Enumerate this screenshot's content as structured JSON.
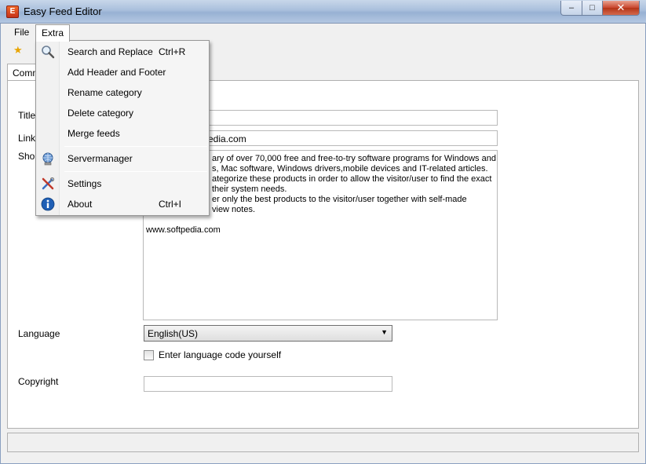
{
  "window": {
    "title": "Easy Feed Editor",
    "app_icon_letter": "E",
    "controls": {
      "minimize": "–",
      "maximize": "□",
      "close": "✕"
    }
  },
  "menubar": {
    "file": "File",
    "extra": "Extra"
  },
  "toolbar": {
    "new_icon": "star-icon"
  },
  "tab": {
    "label": "Comm"
  },
  "form": {
    "title_label": "Title",
    "title_value": "",
    "link_label": "Link",
    "link_value": "edia.com",
    "short_label": "Shor",
    "description_lines": [
      "ary of over 70,000 free and free-to-try software programs for Windows and",
      "s, Mac software, Windows drivers,mobile devices and IT-related articles.",
      "ategorize these products in order to allow the visitor/user to find the exact",
      "their system needs.",
      "er only the best products to the visitor/user together with self-made",
      "view notes.",
      "",
      "www.softpedia.com"
    ],
    "language_label": "Language",
    "language_value": "English(US)",
    "checkbox_label": "Enter language code yourself",
    "copyright_label": "Copyright",
    "copyright_value": ""
  },
  "extra_menu": {
    "items": [
      {
        "label": "Search and Replace",
        "shortcut": "Ctrl+R",
        "icon": "magnifier-icon"
      },
      {
        "label": "Add Header and Footer",
        "shortcut": "",
        "icon": ""
      },
      {
        "label": "Rename category",
        "shortcut": "",
        "icon": ""
      },
      {
        "label": "Delete category",
        "shortcut": "",
        "icon": ""
      },
      {
        "label": "Merge feeds",
        "shortcut": "",
        "icon": ""
      },
      {
        "label": "Servermanager",
        "shortcut": "",
        "icon": "server-globe-icon"
      },
      {
        "label": "Settings",
        "shortcut": "",
        "icon": "settings-tools-icon"
      },
      {
        "label": "About",
        "shortcut": "Ctrl+I",
        "icon": "info-icon"
      }
    ]
  },
  "colors": {
    "titlebar": "#a9bfdc",
    "close_button": "#c8452c",
    "info_icon": "#1f5fb5"
  }
}
